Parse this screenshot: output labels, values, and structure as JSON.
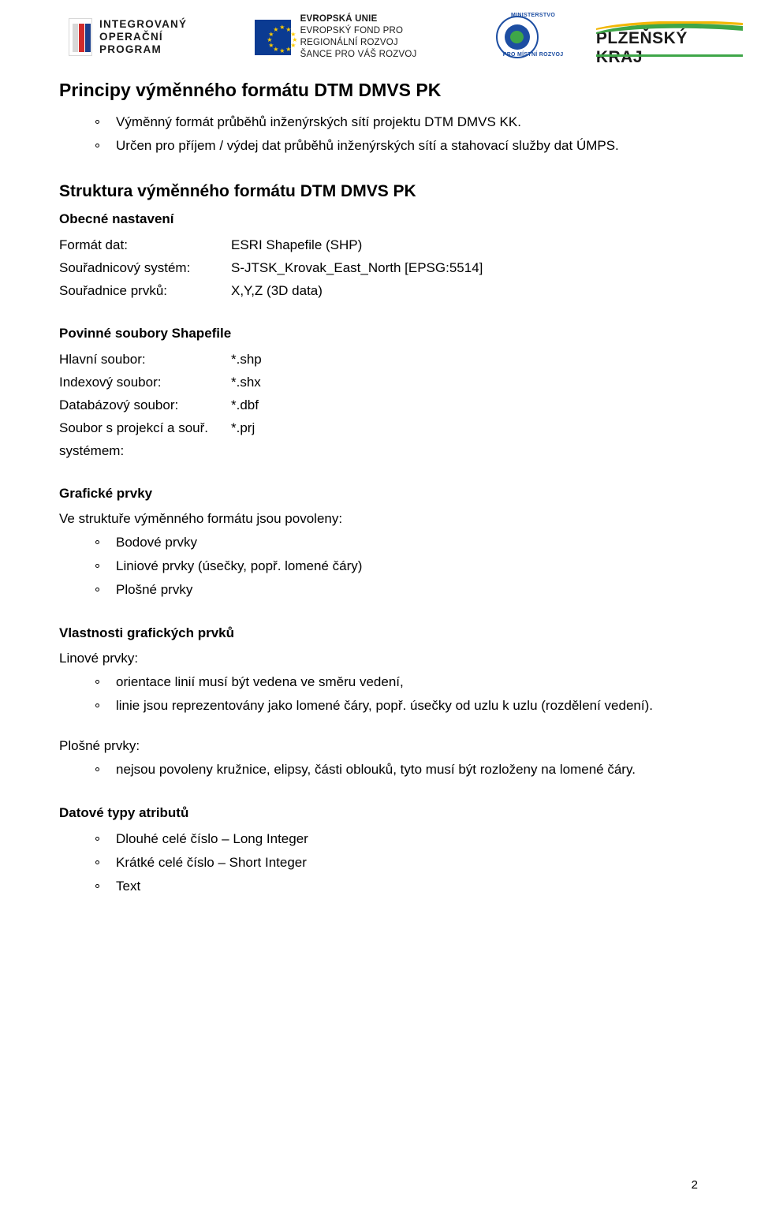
{
  "header": {
    "logos": [
      {
        "name": "integrovany-operacni-program",
        "lines": [
          "INTEGROVANÝ",
          "OPERAČNÍ",
          "PROGRAM"
        ]
      },
      {
        "name": "evropska-unie",
        "lines": [
          "EVROPSKÁ UNIE",
          "EVROPSKÝ FOND PRO REGIONÁLNÍ ROZVOJ",
          "ŠANCE PRO VÁŠ ROZVOJ"
        ]
      },
      {
        "name": "ministerstvo-pro-mistni-rozvoj",
        "lines": [
          "MINISTERSTVO",
          "PRO MÍSTNÍ ROZVOJ"
        ]
      },
      {
        "name": "plzensky-kraj",
        "lines": [
          "PLZEŇSKÝ KRAJ"
        ]
      }
    ]
  },
  "doc": {
    "title": "Principy výměnného formátu DTM DMVS PK",
    "intro_bullets": [
      "Výměnný formát průběhů inženýrských sítí projektu DTM DMVS KK.",
      "Určen pro příjem / výdej dat průběhů inženýrských sítí a stahovací služby dat ÚMPS."
    ],
    "structure_heading": "Struktura výměnného formátu DTM DMVS PK",
    "general": {
      "heading": "Obecné nastavení",
      "rows": [
        {
          "key": "Formát dat:",
          "value": "ESRI Shapefile (SHP)"
        },
        {
          "key": "Souřadnicový systém:",
          "value": "S-JTSK_Krovak_East_North [EPSG:5514]"
        },
        {
          "key": "Souřadnice prvků:",
          "value": "X,Y,Z (3D data)"
        }
      ]
    },
    "required_files": {
      "heading": "Povinné soubory Shapefile",
      "rows": [
        {
          "key": "Hlavní soubor:",
          "value": "*.shp"
        },
        {
          "key": "Indexový soubor:",
          "value": "*.shx"
        },
        {
          "key": "Databázový soubor:",
          "value": "*.dbf"
        },
        {
          "key": "Soubor s projekcí a souř. systémem:",
          "value": "*.prj"
        }
      ]
    },
    "graphic_elements": {
      "heading": "Grafické prvky",
      "lead": "Ve struktuře výměnného formátu jsou povoleny:",
      "items": [
        "Bodové prvky",
        "Liniové prvky (úsečky, popř. lomené čáry)",
        "Plošné prvky"
      ]
    },
    "properties": {
      "heading": "Vlastnosti grafických prvků",
      "line_label": "Linové prvky:",
      "line_items": [
        "orientace linií musí být vedena ve směru vedení,",
        "linie jsou reprezentovány jako lomené čáry, popř. úsečky od uzlu k uzlu (rozdělení vedení)."
      ],
      "area_label": "Plošné prvky:",
      "area_items": [
        "nejsou povoleny kružnice, elipsy, části oblouků, tyto musí být rozloženy na lomené čáry."
      ]
    },
    "data_types": {
      "heading": "Datové typy atributů",
      "items": [
        "Dlouhé celé číslo – Long Integer",
        "Krátké celé číslo – Short Integer",
        "Text"
      ]
    },
    "page_number": "2"
  }
}
